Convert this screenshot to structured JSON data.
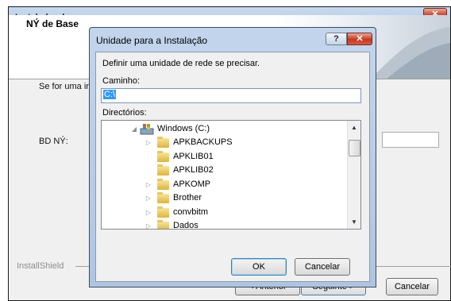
{
  "installer": {
    "title": "Instalador de",
    "close_label": "✕",
    "header_title": "NÝ de Base",
    "description_partial": "Se for uma ir",
    "db_label": "BD NÝ:",
    "installshield_label": "InstallShield",
    "back_label": "< Anterior",
    "next_label": "Seguinte >",
    "cancel_label": "Cancelar"
  },
  "dialog": {
    "title": "Unidade para a Instalação",
    "help_label": "?",
    "close_label": "✕",
    "instruction": "Definir uma unidade de rede se precisar.",
    "path_label": "Caminho:",
    "path_value": "C:\\",
    "dirs_label": "Directórios:",
    "ok_label": "OK",
    "cancel_label": "Cancelar",
    "tree": {
      "root": "Windows (C:)",
      "folders": [
        {
          "name": "APKBACKUPS",
          "expandable": true
        },
        {
          "name": "APKLIB01",
          "expandable": false
        },
        {
          "name": "APKLIB02",
          "expandable": false
        },
        {
          "name": "APKOMP",
          "expandable": true
        },
        {
          "name": "Brother",
          "expandable": true
        },
        {
          "name": "convbitm",
          "expandable": true
        },
        {
          "name": "Dados",
          "expandable": true
        }
      ]
    }
  },
  "colors": {
    "titlebar": "#b3cae6",
    "selection": "#3399ff",
    "close_red": "#c4381f"
  }
}
